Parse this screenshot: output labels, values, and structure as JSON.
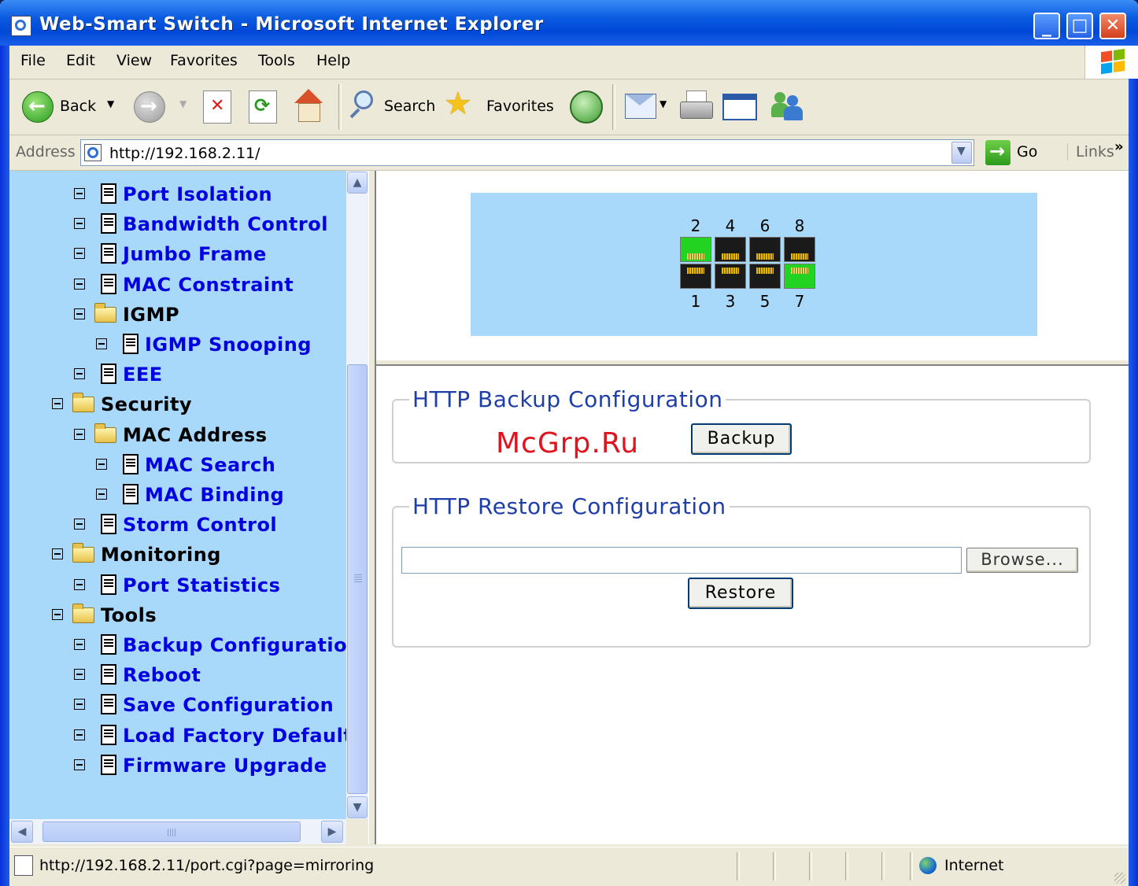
{
  "window": {
    "title": "Web-Smart Switch - Microsoft Internet Explorer",
    "controls": {
      "minimize": "_",
      "maximize": "□",
      "close": "✕"
    }
  },
  "menu": [
    "File",
    "Edit",
    "View",
    "Favorites",
    "Tools",
    "Help"
  ],
  "toolbar": {
    "back_label": "Back",
    "search_label": "Search",
    "favorites_label": "Favorites"
  },
  "address": {
    "label": "Address",
    "url": "http://192.168.2.11/",
    "go_label": "Go",
    "links_label": "Links",
    "chevron": "»"
  },
  "tree": [
    {
      "label": "Port Isolation",
      "type": "doc",
      "level": 2
    },
    {
      "label": "Bandwidth Control",
      "type": "doc",
      "level": 2
    },
    {
      "label": "Jumbo Frame",
      "type": "doc",
      "level": 2
    },
    {
      "label": "MAC Constraint",
      "type": "doc",
      "level": 2
    },
    {
      "label": "IGMP",
      "type": "folder",
      "level": 2
    },
    {
      "label": "IGMP Snooping",
      "type": "doc",
      "level": 3
    },
    {
      "label": "EEE",
      "type": "doc",
      "level": 2
    },
    {
      "label": "Security",
      "type": "folder",
      "level": 1
    },
    {
      "label": "MAC Address",
      "type": "folder",
      "level": 2
    },
    {
      "label": "MAC Search",
      "type": "doc",
      "level": 3
    },
    {
      "label": "MAC Binding",
      "type": "doc",
      "level": 3
    },
    {
      "label": "Storm Control",
      "type": "doc",
      "level": 2
    },
    {
      "label": "Monitoring",
      "type": "folder",
      "level": 1
    },
    {
      "label": "Port Statistics",
      "type": "doc",
      "level": 2
    },
    {
      "label": "Tools",
      "type": "folder",
      "level": 1
    },
    {
      "label": "Backup Configuration",
      "type": "doc",
      "level": 2
    },
    {
      "label": "Reboot",
      "type": "doc",
      "level": 2
    },
    {
      "label": "Save Configuration",
      "type": "doc",
      "level": 2
    },
    {
      "label": "Load Factory Default",
      "type": "doc",
      "level": 2
    },
    {
      "label": "Firmware Upgrade",
      "type": "doc",
      "level": 2
    }
  ],
  "ports": {
    "top": [
      {
        "number": "2",
        "status": "up"
      },
      {
        "number": "4",
        "status": "down"
      },
      {
        "number": "6",
        "status": "down"
      },
      {
        "number": "8",
        "status": "down"
      }
    ],
    "bottom": [
      {
        "number": "1",
        "status": "down"
      },
      {
        "number": "3",
        "status": "down"
      },
      {
        "number": "5",
        "status": "down"
      },
      {
        "number": "7",
        "status": "up"
      }
    ],
    "colors": {
      "up": "#22d322",
      "down": "#1a1a1a"
    }
  },
  "backup": {
    "legend": "HTTP Backup Configuration",
    "button": "Backup"
  },
  "restore": {
    "legend": "HTTP Restore Configuration",
    "file_value": "",
    "browse_button": "Browse...",
    "button": "Restore"
  },
  "watermark": "McGrp.Ru",
  "status": {
    "text": "http://192.168.2.11/port.cgi?page=mirroring",
    "zone": "Internet"
  }
}
